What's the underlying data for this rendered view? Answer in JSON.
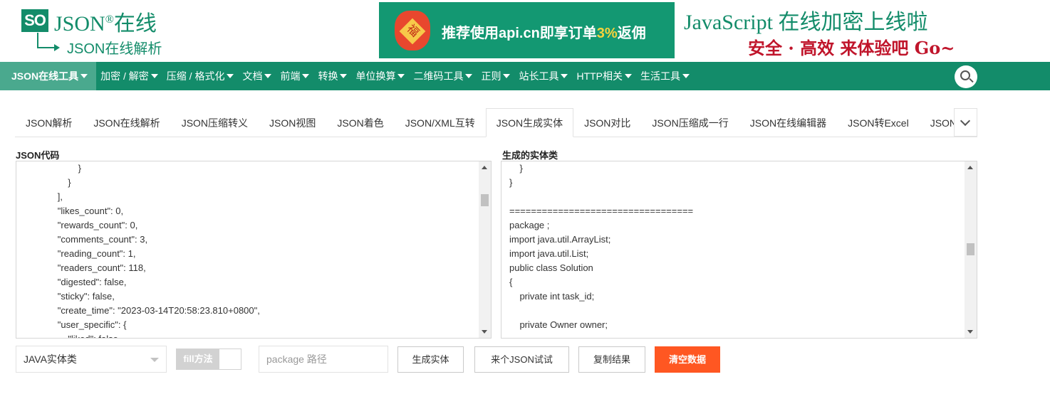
{
  "logo": {
    "badge": "SO",
    "title": "JSON",
    "reg": "®",
    "title_cn": "在线",
    "subtitle": "JSON在线解析"
  },
  "banner": {
    "text_prefix": "推荐使用api.cn即享订单",
    "text_highlight": "3%",
    "text_suffix": "返佣"
  },
  "promo": {
    "line1": "JavaScript 在线加密上线啦",
    "line2": "安全 · 高效  来体验吧 Go~"
  },
  "nav": {
    "items": [
      {
        "label": "JSON在线工具"
      },
      {
        "label": "加密 / 解密"
      },
      {
        "label": "压缩 / 格式化"
      },
      {
        "label": "文档"
      },
      {
        "label": "前端"
      },
      {
        "label": "转换"
      },
      {
        "label": "单位换算"
      },
      {
        "label": "二维码工具"
      },
      {
        "label": "正则"
      },
      {
        "label": "站长工具"
      },
      {
        "label": "HTTP相关"
      },
      {
        "label": "生活工具"
      }
    ]
  },
  "tabs": [
    {
      "label": "JSON解析"
    },
    {
      "label": "JSON在线解析"
    },
    {
      "label": "JSON压缩转义"
    },
    {
      "label": "JSON视图"
    },
    {
      "label": "JSON着色"
    },
    {
      "label": "JSON/XML互转"
    },
    {
      "label": "JSON生成实体"
    },
    {
      "label": "JSON对比"
    },
    {
      "label": "JSON压缩成一行"
    },
    {
      "label": "JSON在线编辑器"
    },
    {
      "label": "JSON转Excel"
    },
    {
      "label": "JSON"
    }
  ],
  "left_panel": {
    "label": "JSON代码",
    "lines": [
      "                        }",
      "                    }",
      "                ],",
      "                \"likes_count\": 0,",
      "                \"rewards_count\": 0,",
      "                \"comments_count\": 3,",
      "                \"reading_count\": 1,",
      "                \"readers_count\": 118,",
      "                \"digested\": false,",
      "                \"sticky\": false,",
      "                \"create_time\": \"2023-03-14T20:58:23.810+0800\",",
      "                \"user_specific\": {",
      "                    \"liked\": false,"
    ]
  },
  "right_panel": {
    "label": "生成的实体类",
    "lines": [
      "    }",
      "}",
      "",
      "==================================",
      "package ;",
      "import java.util.ArrayList;",
      "import java.util.List;",
      "public class Solution",
      "{",
      "    private int task_id;",
      "",
      "    private Owner owner;",
      ""
    ]
  },
  "controls": {
    "language_select": "JAVA实体类",
    "toggle_label": "fill方法",
    "package_placeholder": "package 路径",
    "generate_button": "生成实体",
    "try_json_button": "来个JSON试试",
    "copy_button": "复制结果",
    "clear_button": "清空数据"
  },
  "colors": {
    "brand": "#138c6a",
    "nav_active": "#4aa98e",
    "danger": "#ff5722"
  }
}
